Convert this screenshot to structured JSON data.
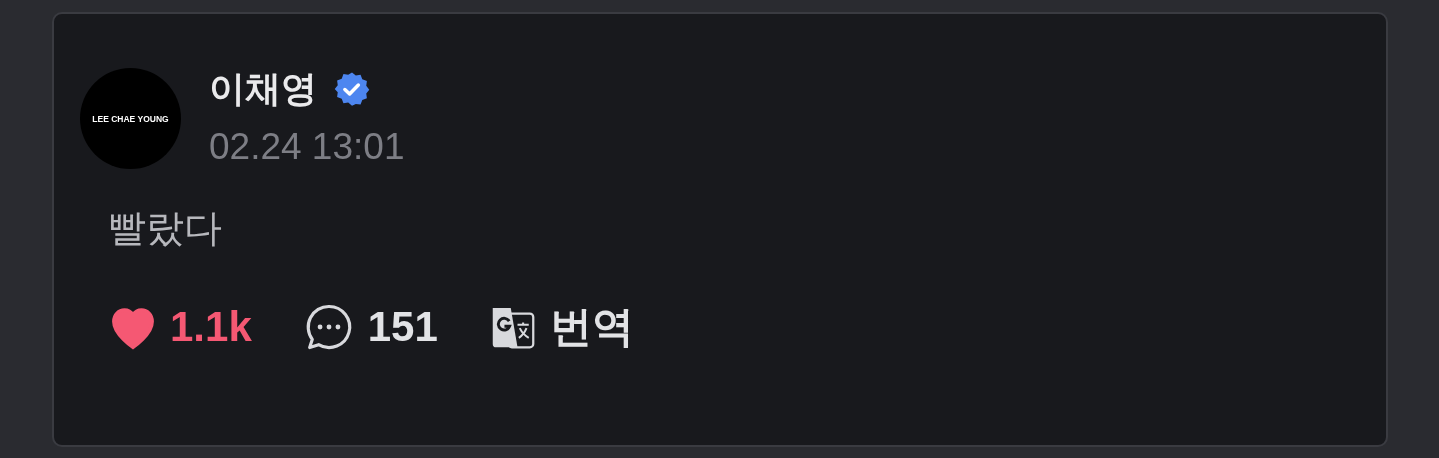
{
  "post": {
    "avatar_text": "LEE CHAE YOUNG",
    "author": "이채영",
    "verified": true,
    "time": "02.24 13:01",
    "body": "빨랐다",
    "actions": [
      {
        "kind": "like",
        "label": "1.1k",
        "liked": true
      },
      {
        "kind": "comment",
        "label": "151"
      },
      {
        "kind": "translate",
        "label": "번역"
      }
    ]
  }
}
